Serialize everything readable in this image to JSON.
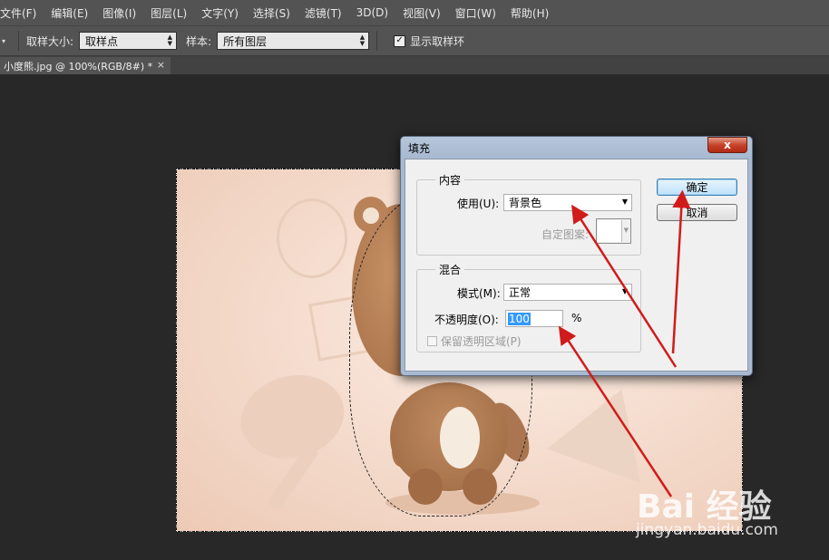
{
  "menu": [
    "文件(F)",
    "编辑(E)",
    "图像(I)",
    "图层(L)",
    "文字(Y)",
    "选择(S)",
    "滤镜(T)",
    "3D(D)",
    "视图(V)",
    "窗口(W)",
    "帮助(H)"
  ],
  "options": {
    "sample_size_label": "取样大小:",
    "sample_size_value": "取样点",
    "sample_label": "样本:",
    "sample_value": "所有图层",
    "show_ring_label": "显示取样环",
    "show_ring_checked": true
  },
  "document_tab": {
    "title": "小度熊.jpg @ 100%(RGB/8#) *",
    "close": "×"
  },
  "dialog": {
    "title": "填充",
    "close": "x",
    "contents_group": "内容",
    "use_label": "使用(U):",
    "use_value": "背景色",
    "custom_pattern_label": "自定图案:",
    "blending_group": "混合",
    "mode_label": "模式(M):",
    "mode_value": "正常",
    "opacity_label": "不透明度(O):",
    "opacity_value": "100",
    "opacity_unit": "%",
    "preserve_label": "保留透明区域(P)",
    "ok_label": "确定",
    "cancel_label": "取消"
  },
  "watermark": {
    "brand": "Bai 经验",
    "url": "jingyan.baidu.com"
  },
  "colors": {
    "annotation_arrow": "#d11b1b",
    "workspace": "#282828",
    "panel": "#535353"
  }
}
